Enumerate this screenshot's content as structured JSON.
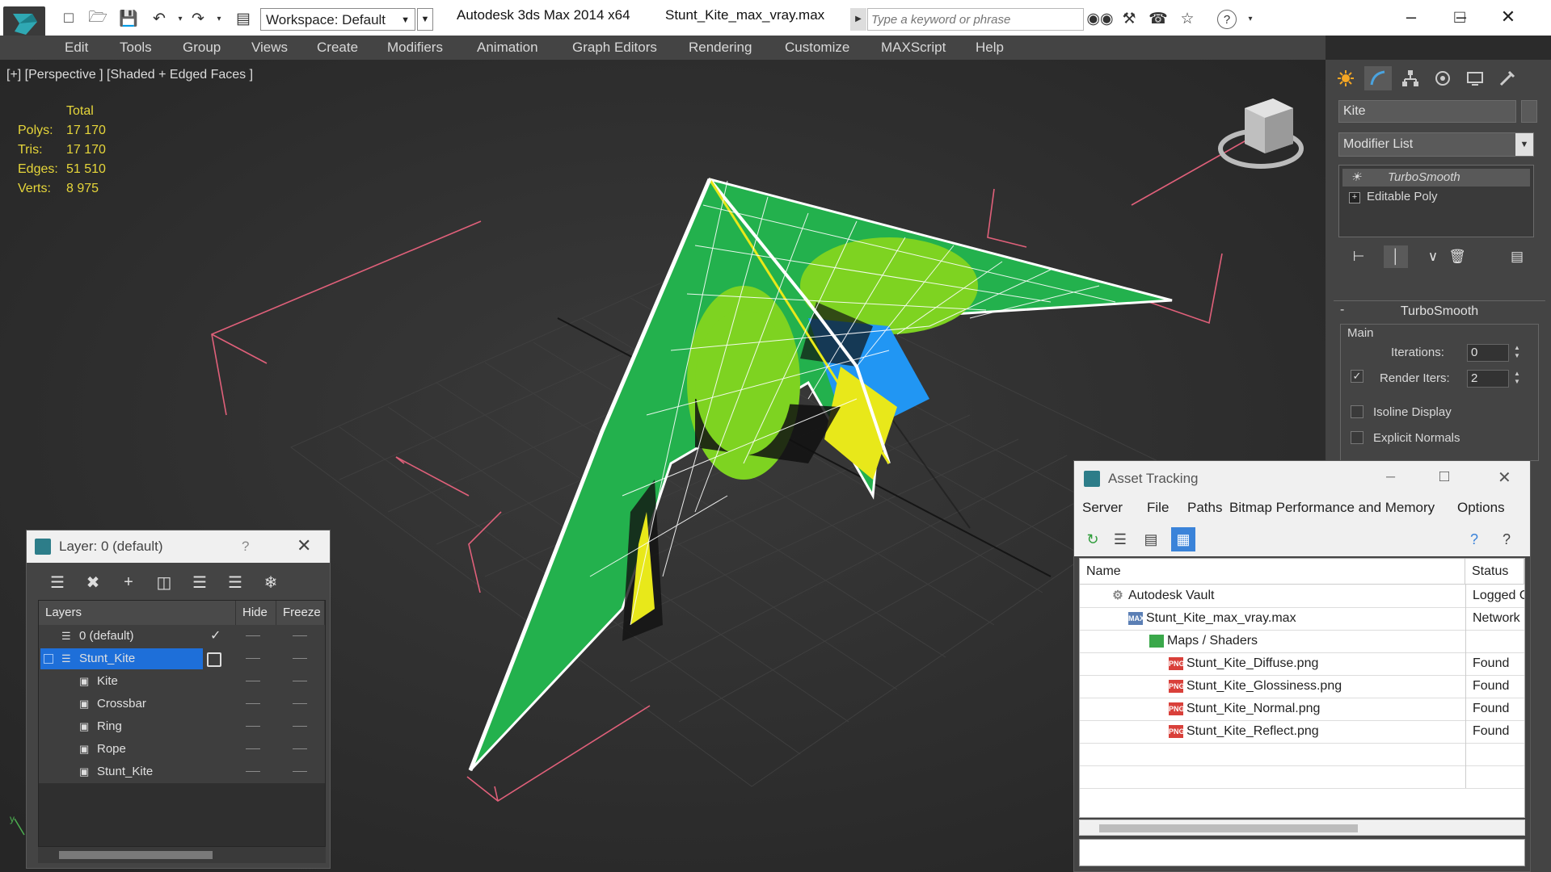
{
  "titlebar": {
    "workspace": "Workspace: Default",
    "app_title": "Autodesk 3ds Max  2014 x64",
    "file_title": "Stunt_Kite_max_vray.max",
    "search_placeholder": "Type a keyword or phrase"
  },
  "menubar": [
    "Edit",
    "Tools",
    "Group",
    "Views",
    "Create",
    "Modifiers",
    "Animation",
    "Graph Editors",
    "Rendering",
    "Customize",
    "MAXScript",
    "Help"
  ],
  "viewport": {
    "label": "[+] [Perspective ] [Shaded + Edged Faces ]",
    "stats_header": "Total",
    "stats": [
      {
        "label": "Polys:",
        "value": "17 170"
      },
      {
        "label": "Tris:",
        "value": "17 170"
      },
      {
        "label": "Edges:",
        "value": "51 510"
      },
      {
        "label": "Verts:",
        "value": "8 975"
      }
    ]
  },
  "command_panel": {
    "object_name": "Kite",
    "modifier_list": "Modifier List",
    "stack": [
      "TurboSmooth",
      "Editable Poly"
    ],
    "rollout_title": "TurboSmooth",
    "group_main": "Main",
    "iterations_label": "Iterations:",
    "iterations_value": "0",
    "render_iters_label": "Render Iters:",
    "render_iters_value": "2",
    "isoline_label": "Isoline Display",
    "explicit_normals_label": "Explicit Normals"
  },
  "layer_window": {
    "title": "Layer: 0 (default)",
    "help": "?",
    "columns": [
      "Layers",
      "Hide",
      "Freeze"
    ],
    "rows": [
      {
        "name": "0 (default)",
        "indent": 0,
        "kind": "layer"
      },
      {
        "name": "Stunt_Kite",
        "indent": 0,
        "kind": "layer",
        "selected": true
      },
      {
        "name": "Kite",
        "indent": 1,
        "kind": "object"
      },
      {
        "name": "Crossbar",
        "indent": 1,
        "kind": "object"
      },
      {
        "name": "Ring",
        "indent": 1,
        "kind": "object"
      },
      {
        "name": "Rope",
        "indent": 1,
        "kind": "object"
      },
      {
        "name": "Stunt_Kite",
        "indent": 1,
        "kind": "object"
      }
    ]
  },
  "asset_window": {
    "title": "Asset Tracking",
    "menu": [
      "Server",
      "File",
      "Paths",
      "Bitmap Performance and Memory",
      "Options"
    ],
    "columns": [
      "Name",
      "Status"
    ],
    "rows": [
      {
        "name": "Autodesk Vault",
        "status": "Logged O",
        "indent": 1,
        "icon": "vault"
      },
      {
        "name": "Stunt_Kite_max_vray.max",
        "status": "Network",
        "indent": 2,
        "icon": "max"
      },
      {
        "name": "Maps / Shaders",
        "status": "",
        "indent": 3,
        "icon": "maps"
      },
      {
        "name": "Stunt_Kite_Diffuse.png",
        "status": "Found",
        "indent": 4,
        "icon": "png"
      },
      {
        "name": "Stunt_Kite_Glossiness.png",
        "status": "Found",
        "indent": 4,
        "icon": "png"
      },
      {
        "name": "Stunt_Kite_Normal.png",
        "status": "Found",
        "indent": 4,
        "icon": "png"
      },
      {
        "name": "Stunt_Kite_Reflect.png",
        "status": "Found",
        "indent": 4,
        "icon": "png"
      }
    ]
  },
  "colors": {
    "kite_green": "#23b14d",
    "kite_lime": "#7ed321",
    "kite_blue": "#2196f3",
    "kite_yellow": "#e8e81a",
    "gizmo_pink": "#e0607a",
    "stats_yellow": "#e6d63a",
    "selection_blue": "#1e6fd9"
  }
}
